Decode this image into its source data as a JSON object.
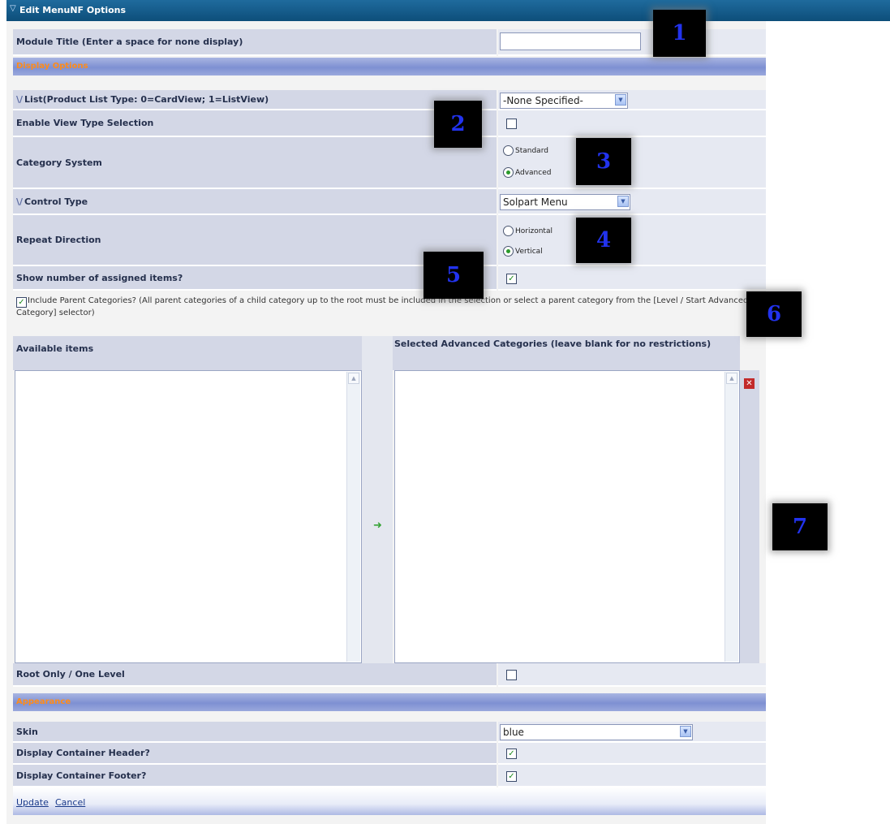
{
  "title": "Edit MenuNF Options",
  "module_title": {
    "label": "Module Title (Enter a space for none display)",
    "value": ""
  },
  "sections": {
    "display": "Display Options",
    "appearance": "Appearance"
  },
  "list_type": {
    "label": "List(Product List Type: 0=CardView; 1=ListView)",
    "value": "-None Specified-"
  },
  "view_type": {
    "label": "Enable View Type Selection",
    "checked": false
  },
  "category_system": {
    "label": "Category System",
    "options": [
      "Standard",
      "Advanced"
    ],
    "selected": "Advanced"
  },
  "control_type": {
    "label": "Control Type",
    "value": "Solpart Menu"
  },
  "repeat_direction": {
    "label": "Repeat Direction",
    "options": [
      "Horizontal",
      "Vertical"
    ],
    "selected": "Vertical"
  },
  "show_count": {
    "label": "Show number of assigned items?",
    "checked": true
  },
  "include_parent": {
    "label": "Include Parent Categories? (All parent categories of a child category up to the root must be included in the selection or select a parent category from the [Level / Start Advanced Category] selector)",
    "checked": true
  },
  "available_items": {
    "label": "Available items"
  },
  "selected_categories": {
    "label": "Selected Advanced Categories (leave blank for no restrictions)"
  },
  "root_only": {
    "label": "Root Only / One Level",
    "checked": false
  },
  "skin": {
    "label": "Skin",
    "value": "blue"
  },
  "container_header": {
    "label": "Display Container Header?",
    "checked": true
  },
  "container_footer": {
    "label": "Display Container Footer?",
    "checked": true
  },
  "actions": {
    "update": "Update",
    "cancel": "Cancel"
  },
  "callouts": [
    "1",
    "2",
    "3",
    "4",
    "5",
    "6",
    "7"
  ],
  "colors": {
    "titlebar": "#0d4e7a",
    "section_text": "#ff8c1a",
    "label_bg": "#d3d7e6",
    "callout_text": "#2233ee"
  }
}
